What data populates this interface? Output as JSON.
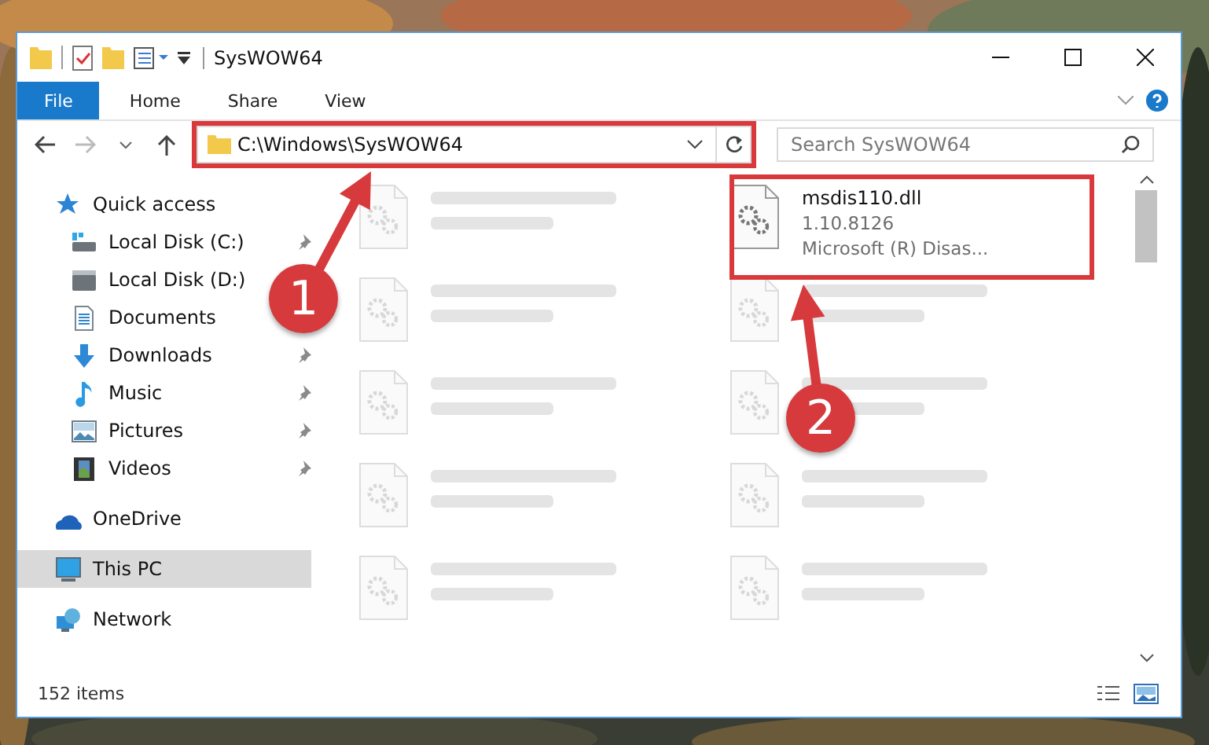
{
  "window": {
    "title": "SysWOW64"
  },
  "ribbon_tabs": [
    {
      "label": "File",
      "kind": "file"
    },
    {
      "label": "Home",
      "kind": "tab"
    },
    {
      "label": "Share",
      "kind": "tab"
    },
    {
      "label": "View",
      "kind": "tab"
    }
  ],
  "address_bar": {
    "path": "C:\\Windows\\SysWOW64"
  },
  "search": {
    "placeholder": "Search SysWOW64"
  },
  "navigation": [
    {
      "label": "Quick access",
      "kind": "star",
      "selected": false,
      "children": [
        {
          "label": "Local Disk (C:)",
          "kind": "drive-c",
          "pinned": true,
          "selected": false
        },
        {
          "label": "Local Disk (D:)",
          "kind": "drive",
          "selected": false
        },
        {
          "label": "Documents",
          "kind": "documents",
          "selected": false
        },
        {
          "label": "Downloads",
          "kind": "downloads",
          "pinned": true,
          "selected": false
        },
        {
          "label": "Music",
          "kind": "music",
          "pinned": true,
          "selected": false
        },
        {
          "label": "Pictures",
          "kind": "pictures",
          "pinned": true,
          "selected": false
        },
        {
          "label": "Videos",
          "kind": "videos",
          "pinned": true,
          "selected": false
        }
      ]
    },
    {
      "label": "OneDrive",
      "kind": "cloud",
      "selected": false
    },
    {
      "label": "This PC",
      "kind": "pc",
      "selected": true
    },
    {
      "label": "Network",
      "kind": "network",
      "selected": false
    }
  ],
  "files": [
    {
      "kind": "blurred"
    },
    {
      "kind": "file",
      "name": "msdis110.dll",
      "version": "1.10.8126",
      "description": "Microsoft (R) Disas..."
    },
    {
      "kind": "blurred"
    },
    {
      "kind": "blurred"
    },
    {
      "kind": "blurred"
    },
    {
      "kind": "blurred"
    },
    {
      "kind": "blurred"
    },
    {
      "kind": "blurred"
    },
    {
      "kind": "blurred"
    },
    {
      "kind": "blurred"
    }
  ],
  "status_bar": {
    "item_count": "152 items"
  },
  "callouts": [
    {
      "number": "1"
    },
    {
      "number": "2"
    }
  ]
}
